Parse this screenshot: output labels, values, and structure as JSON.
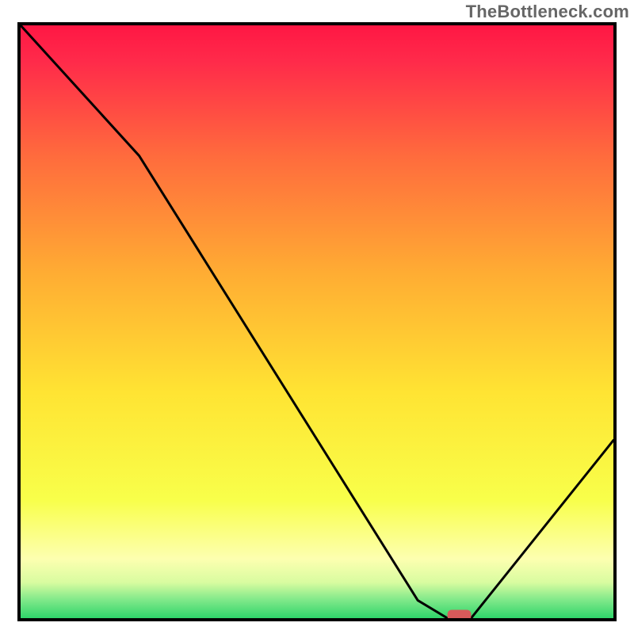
{
  "watermark": "TheBottleneck.com",
  "chart_data": {
    "type": "line",
    "title": "",
    "xlabel": "",
    "ylabel": "",
    "xlim": [
      0,
      100
    ],
    "ylim": [
      0,
      100
    ],
    "series": [
      {
        "name": "bottleneck-curve",
        "x": [
          0,
          20,
          67,
          72,
          76,
          100
        ],
        "y": [
          100,
          78,
          3,
          0,
          0,
          30
        ]
      }
    ],
    "marker": {
      "name": "optimal-range",
      "x_start": 72,
      "x_end": 76,
      "y": 0.5
    },
    "background": {
      "type": "vertical-gradient",
      "stops": [
        {
          "pos": 0.0,
          "color": "#ff1744"
        },
        {
          "pos": 0.06,
          "color": "#ff2a4a"
        },
        {
          "pos": 0.22,
          "color": "#ff6b3d"
        },
        {
          "pos": 0.42,
          "color": "#ffad33"
        },
        {
          "pos": 0.62,
          "color": "#ffe433"
        },
        {
          "pos": 0.8,
          "color": "#f8ff4a"
        },
        {
          "pos": 0.9,
          "color": "#fdffb0"
        },
        {
          "pos": 0.94,
          "color": "#d8fca0"
        },
        {
          "pos": 0.97,
          "color": "#7ee889"
        },
        {
          "pos": 1.0,
          "color": "#2fd56a"
        }
      ]
    },
    "colors": {
      "curve": "#000000",
      "marker": "#d65a5a",
      "frame": "#000000"
    }
  }
}
